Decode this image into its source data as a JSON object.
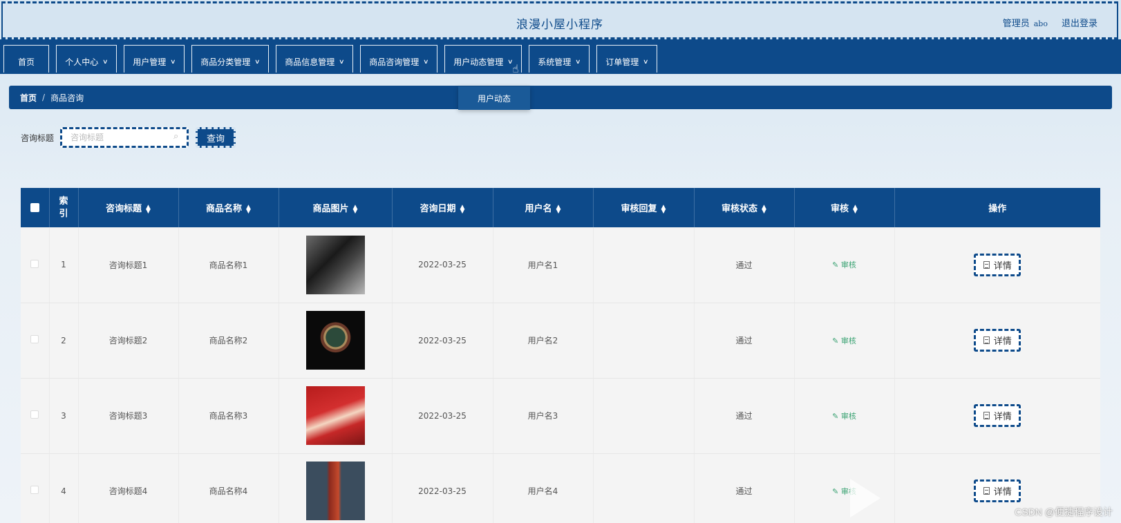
{
  "header": {
    "title": "浪漫小屋小程序",
    "user_role": "管理员",
    "user_name": "abo",
    "logout": "退出登录"
  },
  "nav": {
    "items": [
      {
        "label": "首页",
        "has_dropdown": false
      },
      {
        "label": "个人中心",
        "has_dropdown": true
      },
      {
        "label": "用户管理",
        "has_dropdown": true
      },
      {
        "label": "商品分类管理",
        "has_dropdown": true
      },
      {
        "label": "商品信息管理",
        "has_dropdown": true
      },
      {
        "label": "商品咨询管理",
        "has_dropdown": true
      },
      {
        "label": "用户动态管理",
        "has_dropdown": true
      },
      {
        "label": "系统管理",
        "has_dropdown": true
      },
      {
        "label": "订单管理",
        "has_dropdown": true
      }
    ],
    "open_dropdown": {
      "parent": "用户动态管理",
      "items": [
        "用户动态"
      ]
    }
  },
  "breadcrumb": {
    "home": "首页",
    "separator": "/",
    "current": "商品咨询"
  },
  "search": {
    "label": "咨询标题",
    "placeholder": "咨询标题",
    "button": "查询"
  },
  "table": {
    "columns": [
      "索引",
      "咨询标题",
      "商品名称",
      "商品图片",
      "咨询日期",
      "用户名",
      "审核回复",
      "审核状态",
      "审核",
      "操作"
    ],
    "rows": [
      {
        "index": "1",
        "title": "咨询标题1",
        "product": "商品名称1",
        "image": "bouquet-photo",
        "date": "2022-03-25",
        "user": "用户名1",
        "reply": "",
        "status": "通过",
        "audit": "审核",
        "action": "详情"
      },
      {
        "index": "2",
        "title": "咨询标题2",
        "product": "商品名称2",
        "image": "watch-photo",
        "date": "2022-03-25",
        "user": "用户名2",
        "reply": "",
        "status": "通过",
        "audit": "审核",
        "action": "详情"
      },
      {
        "index": "3",
        "title": "咨询标题3",
        "product": "商品名称3",
        "image": "gift-box-photo",
        "date": "2022-03-25",
        "user": "用户名3",
        "reply": "",
        "status": "通过",
        "audit": "审核",
        "action": "详情"
      },
      {
        "index": "4",
        "title": "咨询标题4",
        "product": "商品名称4",
        "image": "wine-bottle-photo",
        "date": "2022-03-25",
        "user": "用户名4",
        "reply": "",
        "status": "通过",
        "audit": "审核",
        "action": "详情"
      }
    ]
  },
  "watermark": "CSDN @便捷程序设计",
  "colors": {
    "primary": "#0d4a8a",
    "background": "#d7e6f2",
    "audit_link": "#3aa272"
  }
}
